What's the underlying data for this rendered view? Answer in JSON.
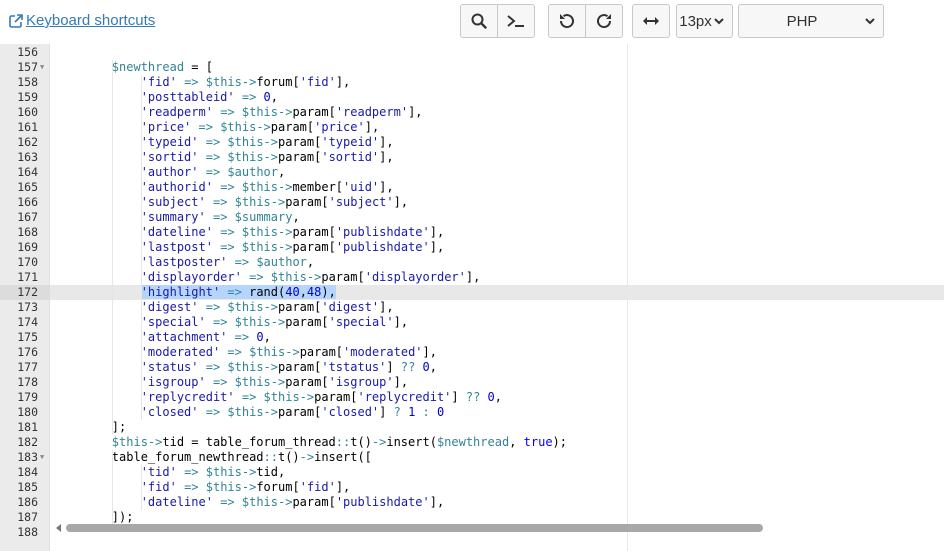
{
  "toolbar": {
    "shortcuts_label": "Keyboard shortcuts",
    "font_size": "13px",
    "language": "PHP",
    "icons": [
      "search-icon",
      "terminal-icon",
      "undo-icon",
      "redo-icon",
      "wrap-icon"
    ]
  },
  "editor": {
    "active_line": 172,
    "lines": [
      {
        "n": "156",
        "fold": false,
        "code": ""
      },
      {
        "n": "157",
        "fold": true,
        "code": "        $newthread = ["
      },
      {
        "n": "158",
        "fold": false,
        "code": "            'fid' => $this->forum['fid'],"
      },
      {
        "n": "159",
        "fold": false,
        "code": "            'posttableid' => 0,"
      },
      {
        "n": "160",
        "fold": false,
        "code": "            'readperm' => $this->param['readperm'],"
      },
      {
        "n": "161",
        "fold": false,
        "code": "            'price' => $this->param['price'],"
      },
      {
        "n": "162",
        "fold": false,
        "code": "            'typeid' => $this->param['typeid'],"
      },
      {
        "n": "163",
        "fold": false,
        "code": "            'sortid' => $this->param['sortid'],"
      },
      {
        "n": "164",
        "fold": false,
        "code": "            'author' => $author,"
      },
      {
        "n": "165",
        "fold": false,
        "code": "            'authorid' => $this->member['uid'],"
      },
      {
        "n": "166",
        "fold": false,
        "code": "            'subject' => $this->param['subject'],"
      },
      {
        "n": "167",
        "fold": false,
        "code": "            'summary' => $summary,"
      },
      {
        "n": "168",
        "fold": false,
        "code": "            'dateline' => $this->param['publishdate'],"
      },
      {
        "n": "169",
        "fold": false,
        "code": "            'lastpost' => $this->param['publishdate'],"
      },
      {
        "n": "170",
        "fold": false,
        "code": "            'lastposter' => $author,"
      },
      {
        "n": "171",
        "fold": false,
        "code": "            'displayorder' => $this->param['displayorder'],"
      },
      {
        "n": "172",
        "fold": false,
        "code": "            'highlight' => rand(40,48),"
      },
      {
        "n": "173",
        "fold": false,
        "code": "            'digest' => $this->param['digest'],"
      },
      {
        "n": "174",
        "fold": false,
        "code": "            'special' => $this->param['special'],"
      },
      {
        "n": "175",
        "fold": false,
        "code": "            'attachment' => 0,"
      },
      {
        "n": "176",
        "fold": false,
        "code": "            'moderated' => $this->param['moderated'],"
      },
      {
        "n": "177",
        "fold": false,
        "code": "            'status' => $this->param['tstatus'] ?? 0,"
      },
      {
        "n": "178",
        "fold": false,
        "code": "            'isgroup' => $this->param['isgroup'],"
      },
      {
        "n": "179",
        "fold": false,
        "code": "            'replycredit' => $this->param['replycredit'] ?? 0,"
      },
      {
        "n": "180",
        "fold": false,
        "code": "            'closed' => $this->param['closed'] ? 1 : 0"
      },
      {
        "n": "181",
        "fold": false,
        "code": "        ];"
      },
      {
        "n": "182",
        "fold": false,
        "code": "        $this->tid = table_forum_thread::t()->insert($newthread, true);"
      },
      {
        "n": "183",
        "fold": true,
        "code": "        table_forum_newthread::t()->insert(["
      },
      {
        "n": "184",
        "fold": false,
        "code": "            'tid' => $this->tid,"
      },
      {
        "n": "185",
        "fold": false,
        "code": "            'fid' => $this->forum['fid'],"
      },
      {
        "n": "186",
        "fold": false,
        "code": "            'dateline' => $this->param['publishdate'],"
      },
      {
        "n": "187",
        "fold": false,
        "code": "        ]);"
      },
      {
        "n": "188",
        "fold": false,
        "code": ""
      }
    ]
  },
  "scrollbar": {
    "position": 0.0
  }
}
